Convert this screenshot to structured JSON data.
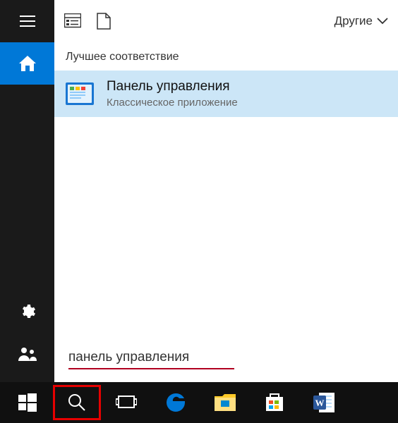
{
  "rail": {
    "menu": "menu",
    "home": "home",
    "settings": "settings",
    "feedback": "feedback"
  },
  "filter": {
    "other_label": "Другие"
  },
  "section": {
    "best_match": "Лучшее соответствие"
  },
  "result": {
    "title": "Панель управления",
    "subtitle": "Классическое приложение"
  },
  "search": {
    "value": "панель управления"
  },
  "taskbar": {
    "start": "start",
    "search": "search",
    "taskview": "task-view",
    "edge": "edge",
    "explorer": "explorer",
    "store": "store",
    "word": "word"
  }
}
